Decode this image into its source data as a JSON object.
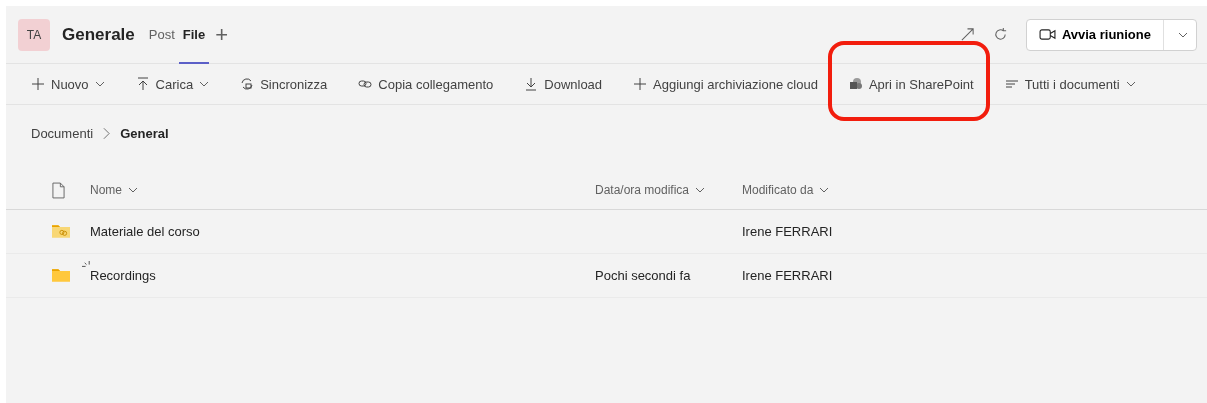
{
  "header": {
    "avatar": "TA",
    "channel": "Generale",
    "tabs": [
      {
        "label": "Post",
        "selected": false
      },
      {
        "label": "File",
        "selected": true
      }
    ],
    "add_tab": "+",
    "meeting_button": "Avvia riunione"
  },
  "toolbar": [
    {
      "label": "Nuovo",
      "dropdown": true,
      "highlighted": false
    },
    {
      "label": "Carica",
      "dropdown": true,
      "highlighted": false
    },
    {
      "label": "Sincronizza",
      "dropdown": false,
      "highlighted": false
    },
    {
      "label": "Copia collegamento",
      "dropdown": false,
      "highlighted": false
    },
    {
      "label": "Download",
      "dropdown": false,
      "highlighted": false
    },
    {
      "label": "Aggiungi archiviazione cloud",
      "dropdown": false,
      "highlighted": false
    },
    {
      "label": "Apri in SharePoint",
      "dropdown": false,
      "highlighted": true
    },
    {
      "label": "Tutti i documenti",
      "dropdown": true,
      "highlighted": false
    }
  ],
  "breadcrumb": [
    "Documenti",
    "General"
  ],
  "table": {
    "columns": [
      "Nome",
      "Data/ora modifica",
      "Modificato da"
    ],
    "rows": [
      {
        "name": "Materiale del corso",
        "kind": "shared",
        "syncing": false,
        "modified_by": "Irene FERRARI"
      },
      {
        "name": "Recordings",
        "kind": "plain",
        "syncing": true,
        "modified": "Pochi secondi fa",
        "modified_by": "Irene FERRARI"
      }
    ]
  }
}
